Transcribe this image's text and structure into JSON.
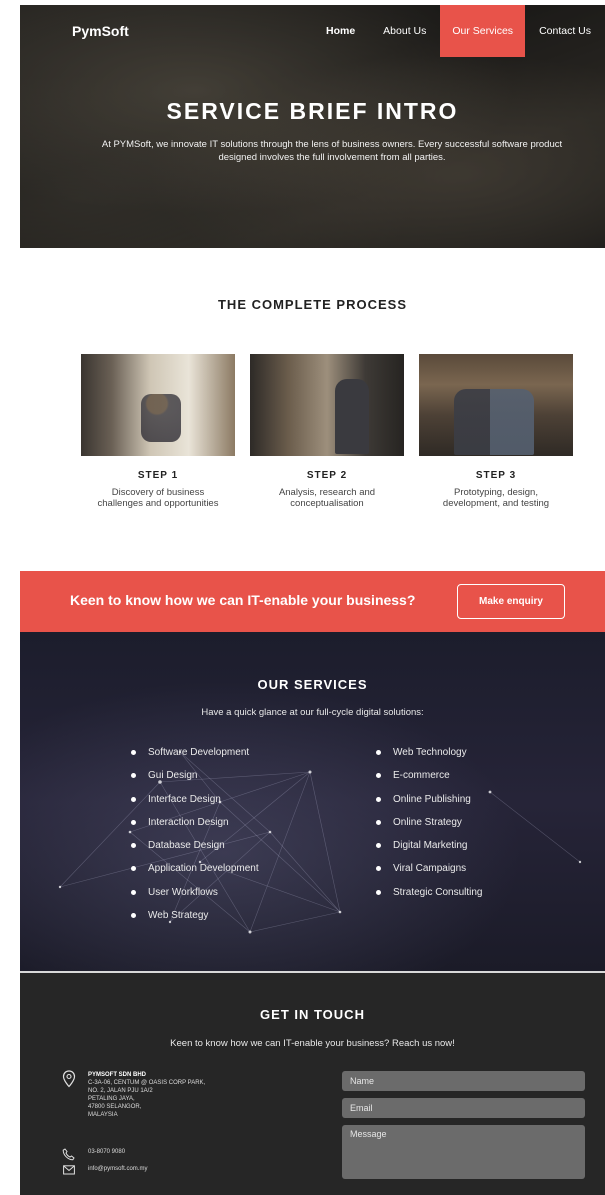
{
  "header": {
    "logo": "PymSoft",
    "nav": [
      "Home",
      "About Us",
      "Our Services",
      "Contact Us"
    ]
  },
  "hero": {
    "title": "SERVICE BRIEF INTRO",
    "text": "At PYMSoft, we innovate IT solutions through the lens of business owners. Every successful software product designed involves the full involvement from all parties."
  },
  "process": {
    "title": "THE COMPLETE PROCESS",
    "steps": [
      {
        "label": "STEP 1",
        "desc": "Discovery of business challenges and opportunities"
      },
      {
        "label": "STEP 2",
        "desc": "Analysis, research and conceptualisation"
      },
      {
        "label": "STEP 3",
        "desc": "Prototyping, design, development, and testing"
      }
    ]
  },
  "cta": {
    "text": "Keen to know how we can IT-enable your business?",
    "button": "Make enquiry"
  },
  "services": {
    "title": "OUR SERVICES",
    "subtitle": "Have a quick glance at our full-cycle digital solutions:",
    "left": [
      "Software Development",
      "Gui Design",
      "Interface Design",
      "Interaction Design",
      "Database Design",
      "Application Development",
      "User Workflows",
      "Web Strategy"
    ],
    "right": [
      "Web Technology",
      "E-commerce",
      "Online Publishing",
      "Online Strategy",
      "Digital Marketing",
      "Viral Campaigns",
      "Strategic Consulting"
    ]
  },
  "contact": {
    "title": "GET IN TOUCH",
    "subtitle": "Keen to know how we can IT-enable your business? Reach us now!",
    "company": "PYMSOFT SDN BHD",
    "address": [
      "C-3A-06, CENTUM @ OASIS CORP PARK,",
      "NO. 2, JALAN PJU 1A/2",
      "PETALING JAYA,",
      "47800 SELANGOR,",
      "MALAYSIA"
    ],
    "phone": "03-8070 9080",
    "email": "info@pymsoft.com.my",
    "form": {
      "name_placeholder": "Name",
      "email_placeholder": "Email",
      "message_placeholder": "Message"
    }
  },
  "colors": {
    "accent": "#e8534a",
    "dark": "#262626",
    "navy": "#1c1d2c"
  },
  "icons": [
    "location-pin-icon",
    "phone-icon",
    "mail-icon"
  ]
}
